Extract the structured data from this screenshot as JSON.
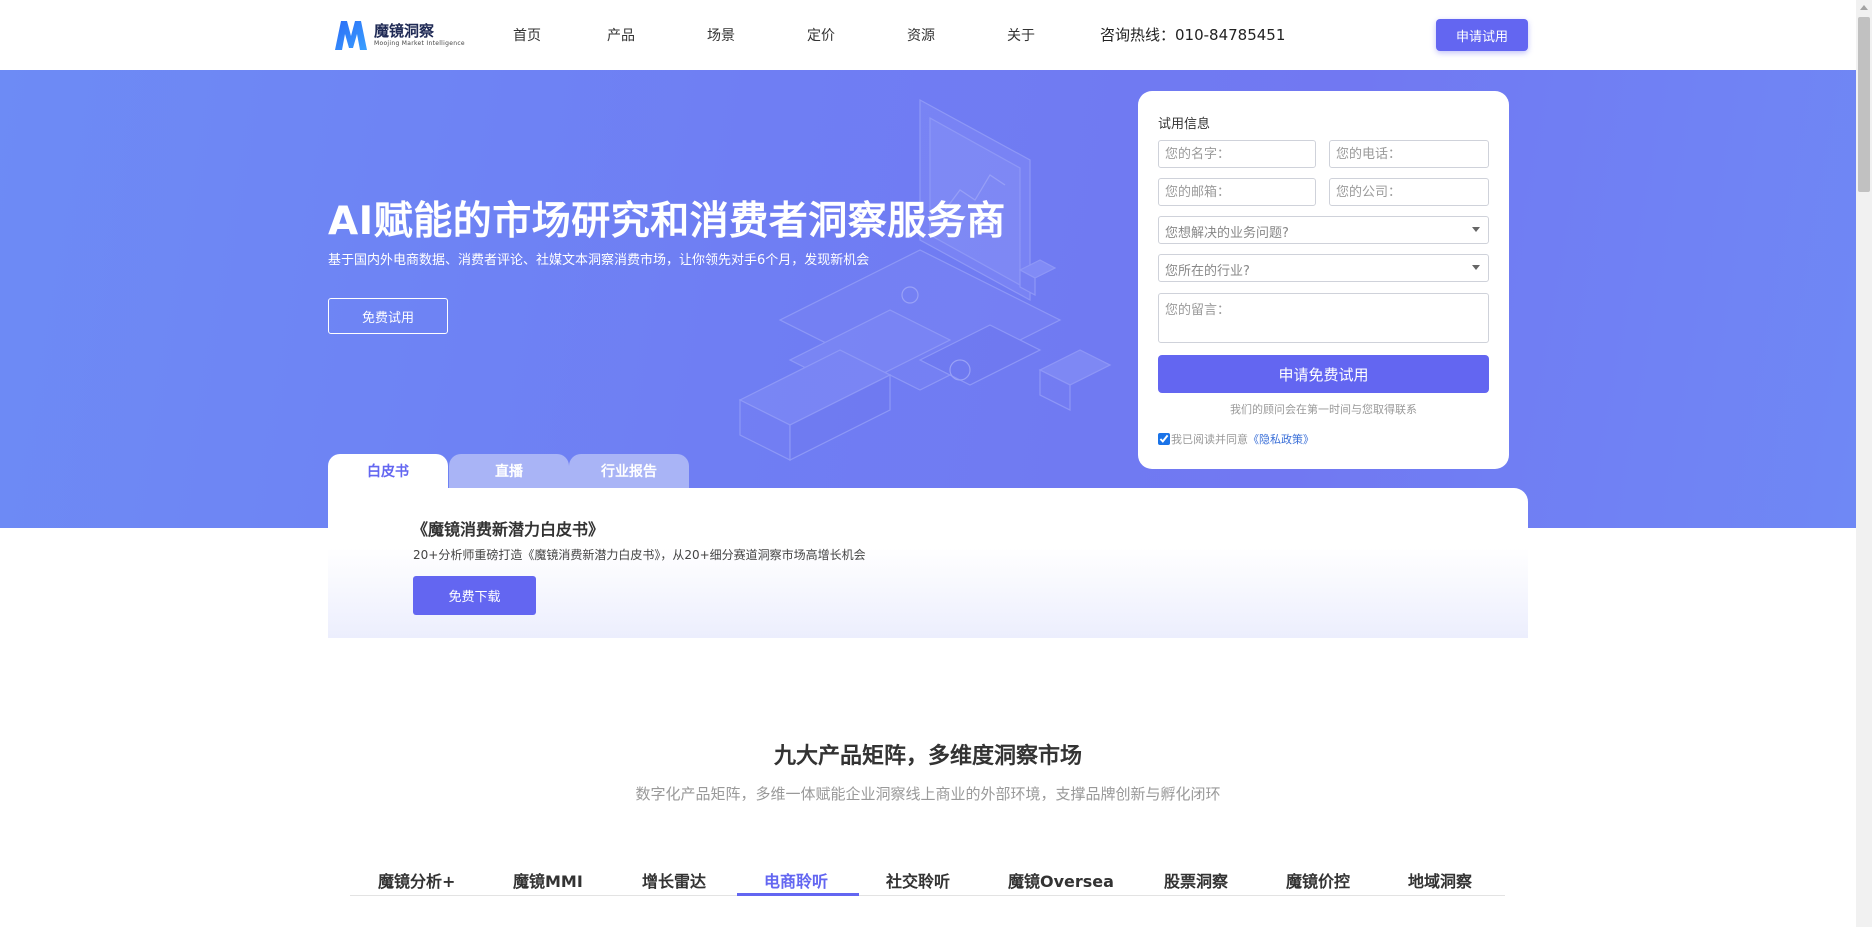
{
  "header": {
    "logo_name": "魔镜洞察",
    "logo_sub": "Moojing Market Intelligence",
    "nav": [
      "首页",
      "产品",
      "场景",
      "定价",
      "资源",
      "关于"
    ],
    "hotline": "咨询热线：010-84785451",
    "apply_label": "申请试用"
  },
  "hero": {
    "title": "AI赋能的市场研究和消费者洞察服务商",
    "subtitle": "基于国内外电商数据、消费者评论、社媒文本洞察消费市场，让你领先对手6个月，发现新机会",
    "cta_label": "免费试用"
  },
  "form": {
    "title": "试用信息",
    "name_placeholder": "您的名字：",
    "phone_placeholder": "您的电话：",
    "email_placeholder": "您的邮箱：",
    "company_placeholder": "您的公司：",
    "problem_select": "您想解决的业务问题?",
    "industry_select": "您所在的行业?",
    "message_placeholder": "您的留言：",
    "submit_label": "申请免费试用",
    "note": "我们的顾问会在第一时间与您取得联系",
    "agree_text": "我已阅读并同意",
    "privacy_link": "《隐私政策》",
    "agree_checked": true
  },
  "resource_tabs": {
    "tabs": [
      "白皮书",
      "直播",
      "行业报告"
    ],
    "active": "白皮书",
    "card_title": "《魔镜消费新潜力白皮书》",
    "card_desc": "20+分析师重磅打造《魔镜消费新潜力白皮书》，从20+细分赛道洞察市场高增长机会",
    "card_btn": "免费下载"
  },
  "products": {
    "title": "九大产品矩阵，多维度洞察市场",
    "subtitle": "数字化产品矩阵，多维一体赋能企业洞察线上商业的外部环境，支撑品牌创新与孵化闭环",
    "tabs": [
      "魔镜分析+",
      "魔镜MMI",
      "增长雷达",
      "电商聆听",
      "社交聆听",
      "魔镜Oversea",
      "股票洞察",
      "魔镜价控",
      "地域洞察"
    ],
    "active": "电商聆听"
  },
  "colors": {
    "accent": "#6366f1",
    "hero_bg": "#7078f2",
    "link": "#3a6fd8"
  }
}
